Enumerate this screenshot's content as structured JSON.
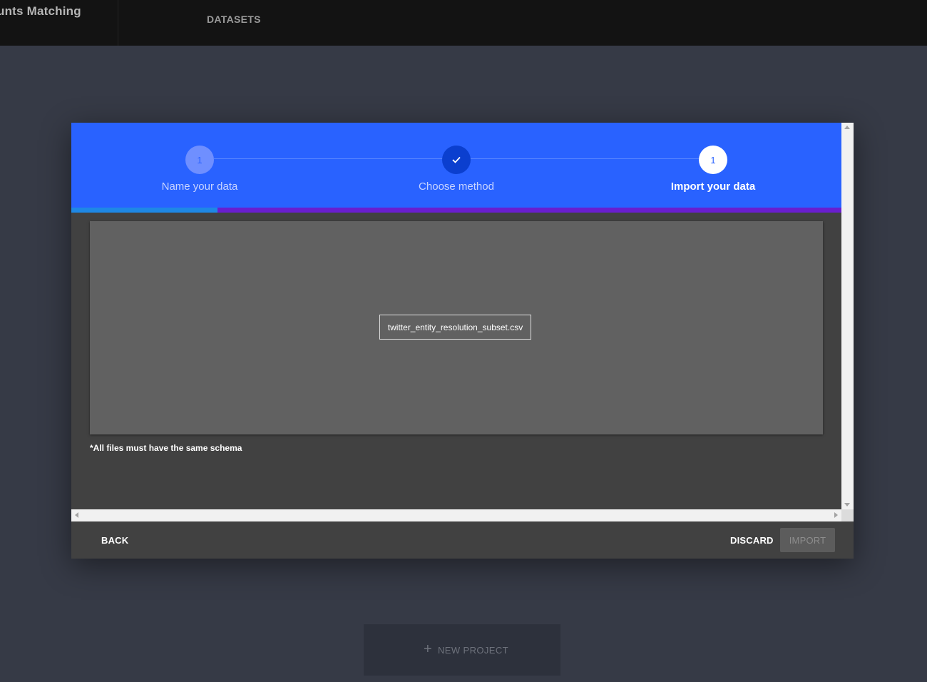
{
  "app": {
    "title": "unts Matching"
  },
  "nav": {
    "datasets_label": "DATASETS"
  },
  "background": {
    "new_project_label": "NEW PROJECT",
    "new_project_icon": "plus-icon"
  },
  "dialog": {
    "steps": [
      {
        "number": "1",
        "label": "Name your data",
        "state": "done-light"
      },
      {
        "number": "",
        "label": "Choose method",
        "state": "completed",
        "icon": "check-icon"
      },
      {
        "number": "1",
        "label": "Import your data",
        "state": "active"
      }
    ],
    "progress": 0.19,
    "file_name": "twitter_entity_resolution_subset.csv",
    "schema_note": "*All files must have the same schema",
    "footer": {
      "back_label": "BACK",
      "discard_label": "DISCARD",
      "import_label": "IMPORT"
    }
  },
  "colors": {
    "stepper_bg": "#2962ff",
    "progress_fill": "#1e88e5",
    "progress_track": "#6a1ecf",
    "page_bg": "#363a46",
    "topbar_bg": "#131313"
  }
}
